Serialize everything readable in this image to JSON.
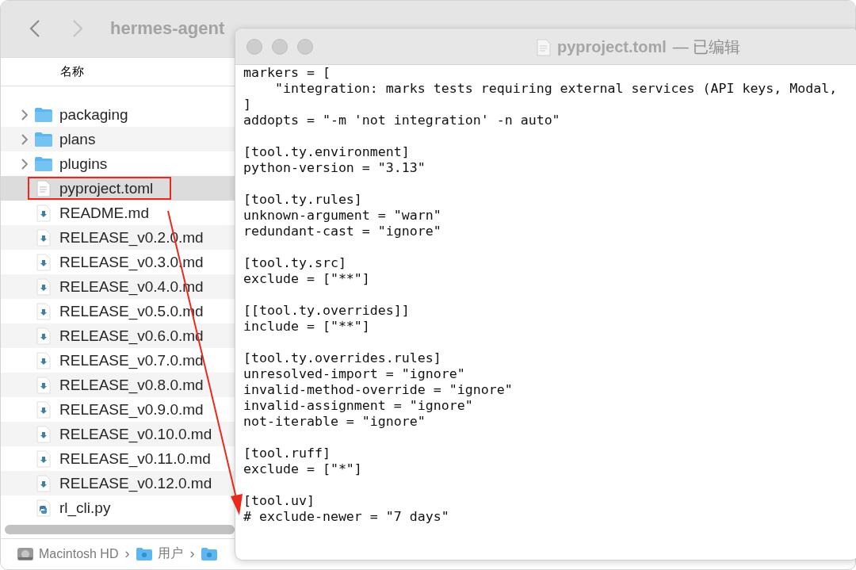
{
  "finder": {
    "title": "hermes-agent",
    "column_header": "名称",
    "items": [
      {
        "name": "packaging",
        "kind": "folder",
        "selected": false
      },
      {
        "name": "plans",
        "kind": "folder",
        "selected": false
      },
      {
        "name": "plugins",
        "kind": "folder",
        "selected": false
      },
      {
        "name": "pyproject.toml",
        "kind": "text",
        "selected": true,
        "annotated": true
      },
      {
        "name": "README.md",
        "kind": "markdown",
        "selected": false
      },
      {
        "name": "RELEASE_v0.2.0.md",
        "kind": "markdown",
        "selected": false
      },
      {
        "name": "RELEASE_v0.3.0.md",
        "kind": "markdown",
        "selected": false
      },
      {
        "name": "RELEASE_v0.4.0.md",
        "kind": "markdown",
        "selected": false
      },
      {
        "name": "RELEASE_v0.5.0.md",
        "kind": "markdown",
        "selected": false
      },
      {
        "name": "RELEASE_v0.6.0.md",
        "kind": "markdown",
        "selected": false
      },
      {
        "name": "RELEASE_v0.7.0.md",
        "kind": "markdown",
        "selected": false
      },
      {
        "name": "RELEASE_v0.8.0.md",
        "kind": "markdown",
        "selected": false
      },
      {
        "name": "RELEASE_v0.9.0.md",
        "kind": "markdown",
        "selected": false
      },
      {
        "name": "RELEASE_v0.10.0.md",
        "kind": "markdown",
        "selected": false
      },
      {
        "name": "RELEASE_v0.11.0.md",
        "kind": "markdown",
        "selected": false
      },
      {
        "name": "RELEASE_v0.12.0.md",
        "kind": "markdown",
        "selected": false
      },
      {
        "name": "rl_cli.py",
        "kind": "python",
        "selected": false
      }
    ],
    "path_bar": [
      {
        "label": "Macintosh HD",
        "kind": "disk"
      },
      {
        "label": "›",
        "kind": "separator"
      },
      {
        "label": "用户",
        "kind": "folder"
      },
      {
        "label": "›",
        "kind": "separator"
      },
      {
        "kind": "folder"
      }
    ]
  },
  "editor": {
    "title": "pyproject.toml",
    "title_status": "— 已编辑",
    "blocks": [
      [
        "markers = [",
        "    \"integration: marks tests requiring external services (API keys, Modal,",
        "]",
        "addopts = \"-m 'not integration' -n auto\""
      ],
      [
        "[tool.ty.environment]",
        "python-version = \"3.13\""
      ],
      [
        "[tool.ty.rules]",
        "unknown-argument = \"warn\"",
        "redundant-cast = \"ignore\""
      ],
      [
        "[tool.ty.src]",
        "exclude = [\"**\"]"
      ],
      [
        "[[tool.ty.overrides]]",
        "include = [\"**\"]"
      ],
      [
        "[tool.ty.overrides.rules]",
        "unresolved-import = \"ignore\"",
        "invalid-method-override = \"ignore\"",
        "invalid-assignment = \"ignore\"",
        "not-iterable = \"ignore\""
      ],
      [
        "[tool.ruff]",
        "exclude = [\"*\"]"
      ],
      [
        "[tool.uv]",
        "# exclude-newer = \"7 days\""
      ]
    ]
  },
  "annotation": {
    "kind": "frame_and_arrow"
  }
}
